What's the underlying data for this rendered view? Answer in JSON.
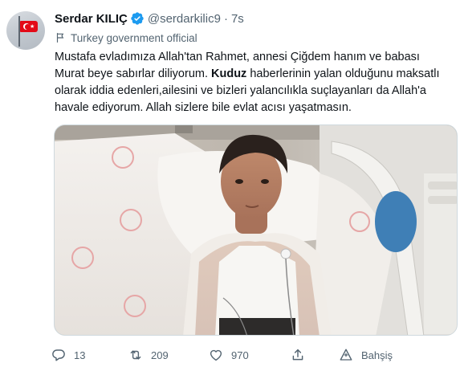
{
  "tweet": {
    "author_name": "Serdar KILIÇ",
    "handle": "@serdarkilic9",
    "separator": "·",
    "time": "7s",
    "label": "Turkey government official",
    "text_part1": "Mustafa evladımıza Allah'tan Rahmet, annesi Çiğdem hanım ve babası Murat beye sabırlar  diliyorum. ",
    "text_bold": "Kuduz",
    "text_part2": " haberlerinin yalan olduğunu maksatlı olarak iddia edenleri,ailesini ve bizleri yalancılıkla suçlayanları da Allah'a havale ediyorum. Allah sizlere bile evlat acısı yaşatmasın."
  },
  "actions": {
    "replies": "13",
    "retweets": "209",
    "likes": "970",
    "tip_label": "Bahşiş"
  },
  "icons": {
    "avatar": "turkish-flag-avatar",
    "verified": "verified-badge-icon",
    "label": "flag-icon",
    "reply": "reply-icon",
    "retweet": "retweet-icon",
    "like": "heart-icon",
    "share": "share-icon",
    "tip": "tip-icon"
  },
  "colors": {
    "verified_blue": "#1d9bf0",
    "secondary_text": "#536471",
    "primary_text": "#0f1419",
    "flag_red": "#e30a17"
  }
}
